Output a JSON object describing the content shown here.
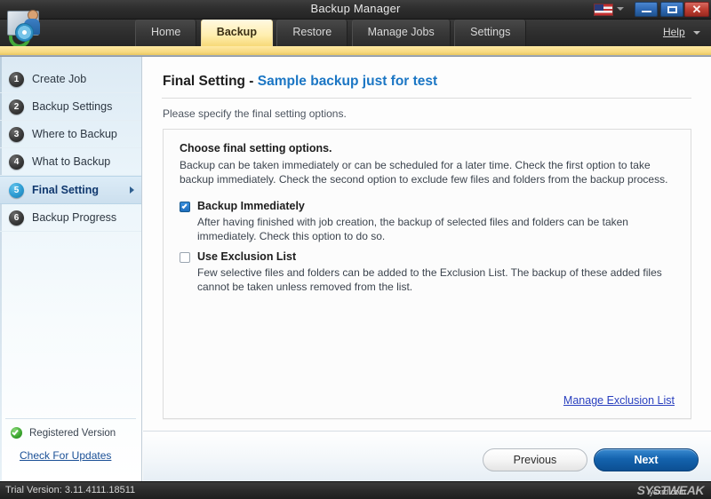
{
  "window": {
    "title": "Backup Manager",
    "app_icon": "backup-folder-disc-icon",
    "language_flag": "us-flag-icon",
    "minimize_label": "Minimize",
    "maximize_label": "Maximize",
    "close_label": "✕"
  },
  "nav": {
    "tabs": [
      {
        "label": "Home",
        "active": false
      },
      {
        "label": "Backup",
        "active": true
      },
      {
        "label": "Restore",
        "active": false
      },
      {
        "label": "Manage Jobs",
        "active": false
      },
      {
        "label": "Settings",
        "active": false
      }
    ],
    "help_label": "Help"
  },
  "sidebar": {
    "steps": [
      {
        "number": "1",
        "label": "Create Job",
        "active": false
      },
      {
        "number": "2",
        "label": "Backup Settings",
        "active": false
      },
      {
        "number": "3",
        "label": "Where to Backup",
        "active": false
      },
      {
        "number": "4",
        "label": "What to Backup",
        "active": false
      },
      {
        "number": "5",
        "label": "Final Setting",
        "active": true
      },
      {
        "number": "6",
        "label": "Backup Progress",
        "active": false
      }
    ],
    "registered_label": "Registered Version",
    "update_link": "Check For Updates"
  },
  "main": {
    "title_prefix": "Final Setting - ",
    "job_name": "Sample backup just for test",
    "subtitle": "Please specify the final setting options.",
    "panel": {
      "heading": "Choose final setting options.",
      "description": "Backup can be taken immediately or can be scheduled for a later time. Check the first option to take backup immediately. Check the second option to exclude few files and folders from the backup process.",
      "options": [
        {
          "label": "Backup Immediately",
          "checked": true,
          "description": "After having finished with job creation, the backup of selected files and folders can be taken immediately. Check this option to do so."
        },
        {
          "label": "Use Exclusion List",
          "checked": false,
          "description": "Few selective files and folders can be added to the Exclusion List. The backup of these added files cannot be taken unless removed from the list."
        }
      ],
      "exclusion_link": "Manage Exclusion List"
    }
  },
  "footer": {
    "previous_label": "Previous",
    "next_label": "Next"
  },
  "statusbar": {
    "trial_text": "Trial Version: 3.11.4111.18511",
    "watermark": "SYSTWEAK",
    "watermark_sub": "ysxrd.com"
  },
  "colors": {
    "accent_gold": "#f6d87e",
    "accent_blue": "#1b76c4",
    "primary_button": "#1463ae",
    "link": "#2a40bf",
    "sidebar_active": "#10386e",
    "registered_green": "#3ba52f"
  }
}
